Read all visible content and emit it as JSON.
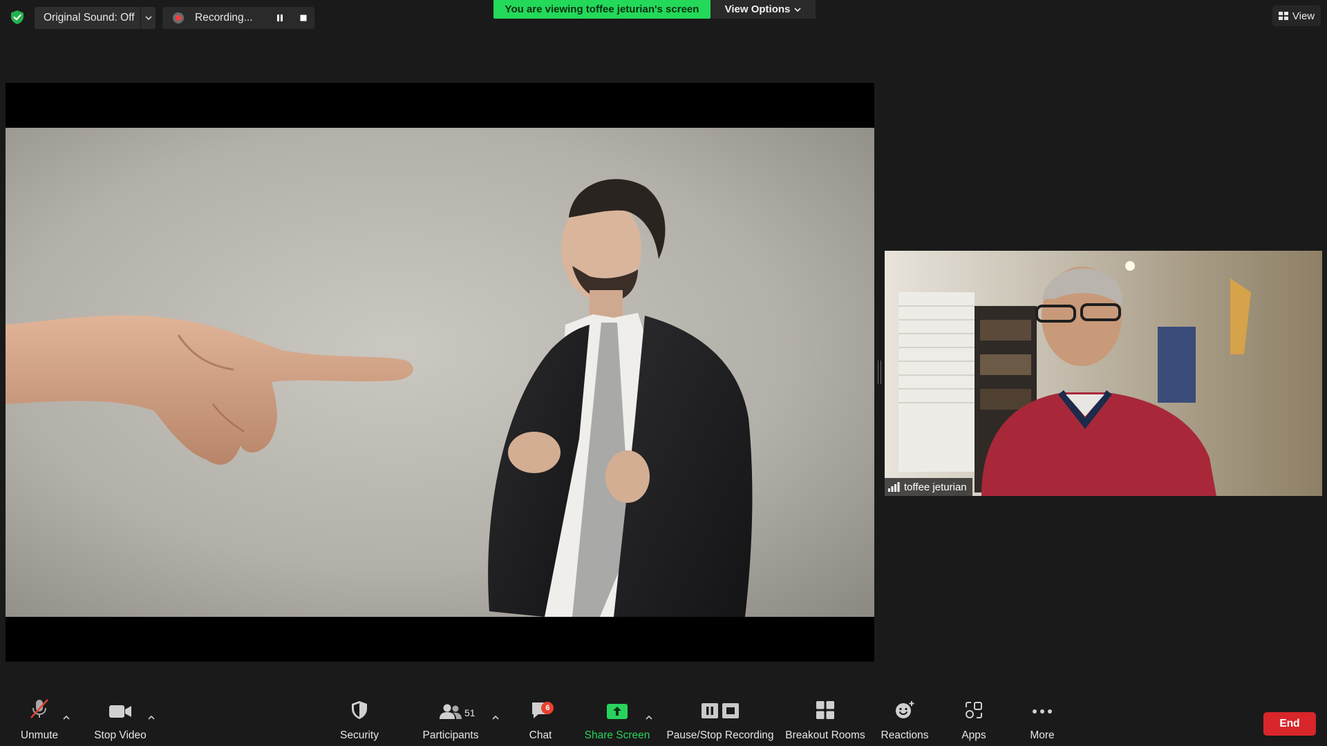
{
  "top_bar": {
    "original_sound_label": "Original Sound: Off",
    "recording_label": "Recording...",
    "viewing_banner": "You are viewing toffee jeturian's screen",
    "view_options_label": "View Options",
    "view_label": "View"
  },
  "participant": {
    "name": "toffee jeturian"
  },
  "toolbar": {
    "unmute": "Unmute",
    "stop_video": "Stop Video",
    "security": "Security",
    "participants": "Participants",
    "participants_count": "51",
    "chat": "Chat",
    "chat_badge": "6",
    "share_screen": "Share Screen",
    "pause_stop_recording": "Pause/Stop Recording",
    "breakout_rooms": "Breakout Rooms",
    "reactions": "Reactions",
    "apps": "Apps",
    "more": "More",
    "end": "End"
  },
  "colors": {
    "background": "#1a1a1a",
    "banner_green": "#23d959",
    "share_green": "#28d35c",
    "end_red": "#d8262a",
    "recording_red": "#ff3b3b",
    "badge_red": "#e8412e"
  },
  "icons": [
    "shield-check-icon",
    "chevron-down-icon",
    "record-dot-icon",
    "pause-icon",
    "stop-icon",
    "grid-view-icon",
    "signal-icon",
    "muted-mic-icon",
    "video-camera-icon",
    "security-shield-icon",
    "participants-icon",
    "chat-bubble-icon",
    "share-screen-icon",
    "pause-stop-recording-icon",
    "breakout-rooms-icon",
    "reactions-icon",
    "apps-icon",
    "more-dots-icon"
  ]
}
